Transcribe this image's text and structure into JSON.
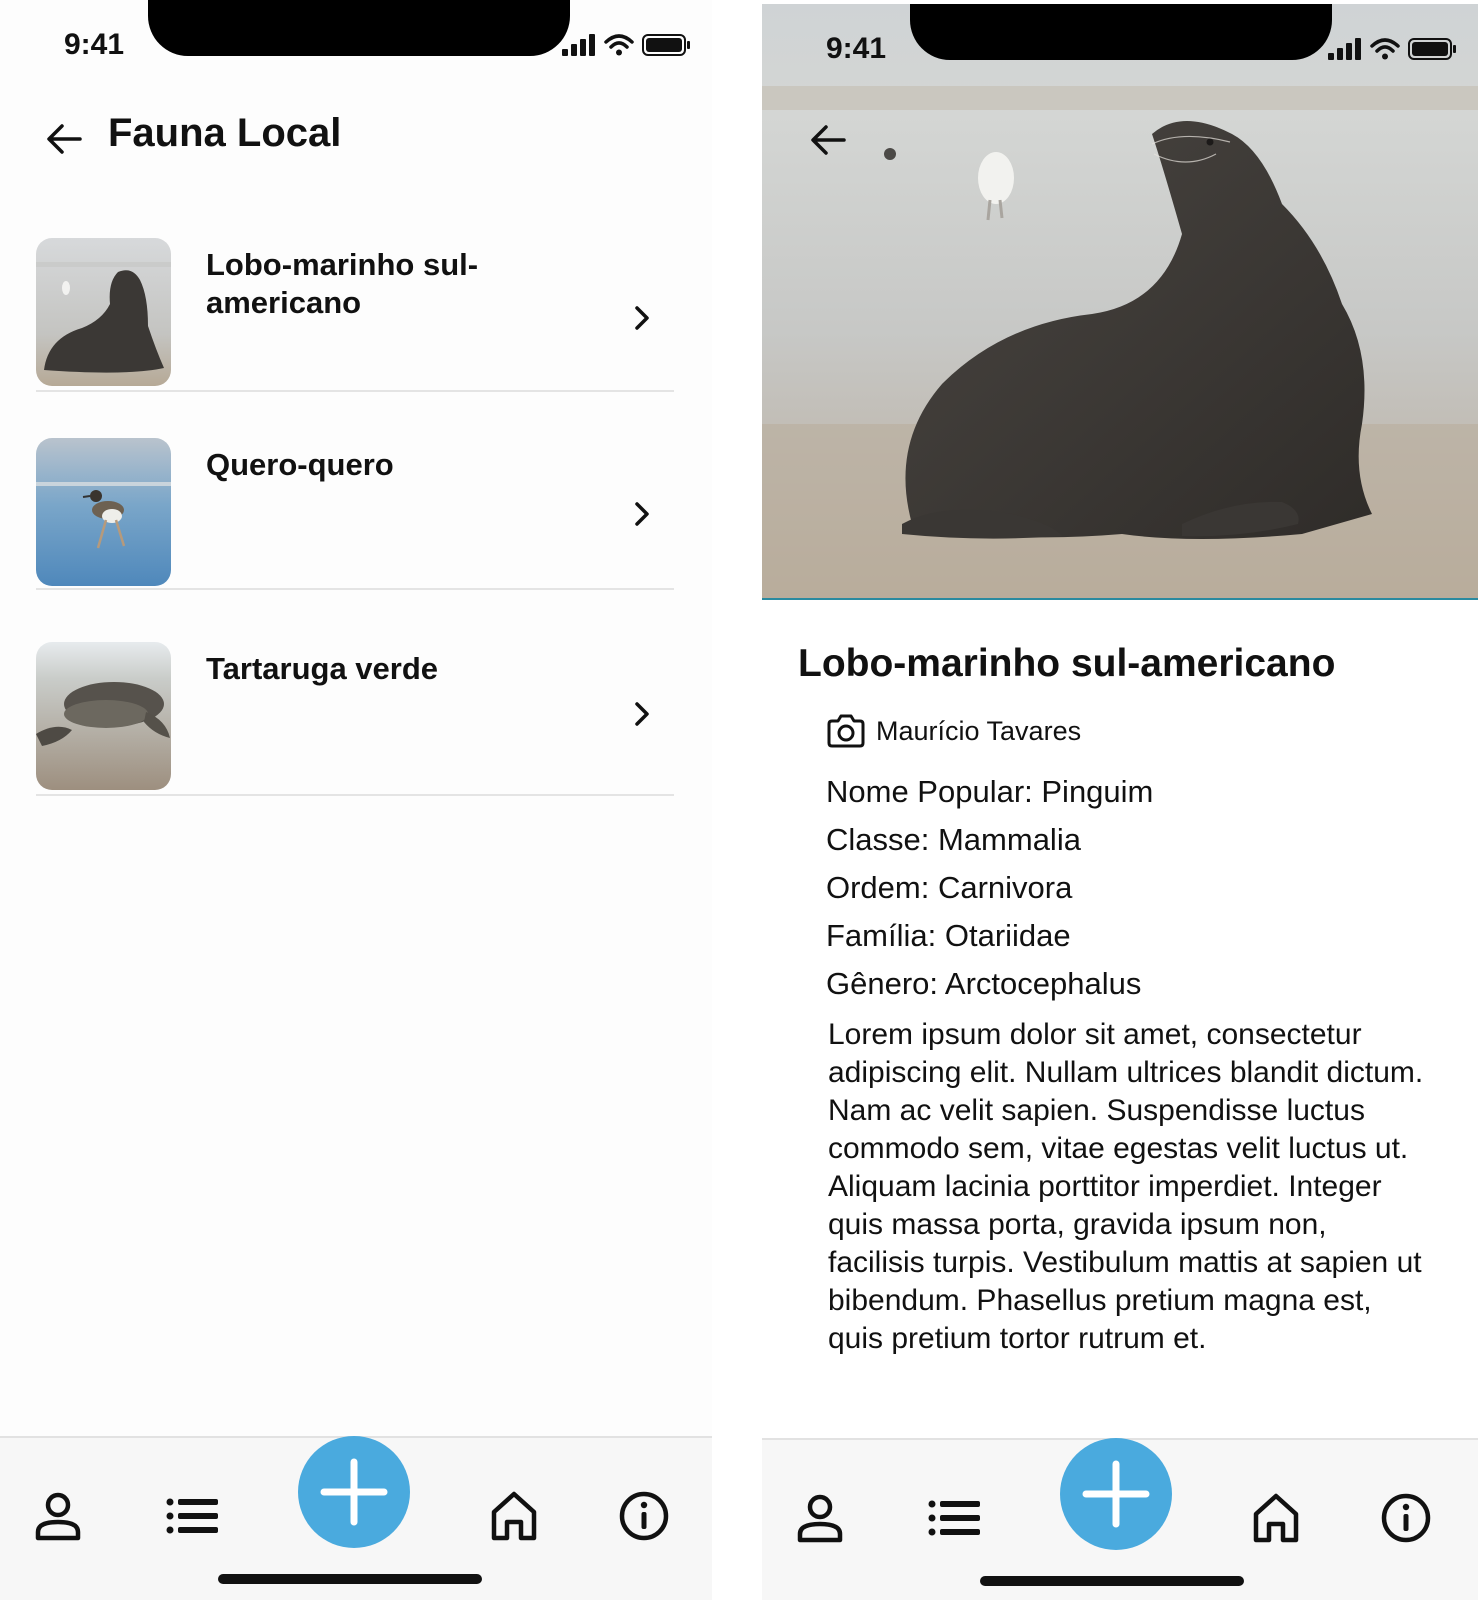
{
  "status_bar": {
    "time": "9:41"
  },
  "list_screen": {
    "title": "Fauna Local",
    "items": [
      {
        "name": "Lobo-marinho sul-americano"
      },
      {
        "name": "Quero-quero"
      },
      {
        "name": "Tartaruga verde"
      }
    ]
  },
  "detail_screen": {
    "title": "Lobo-marinho sul-americano",
    "photo_credit": "Maurício Tavares",
    "facts": [
      "Nome Popular: Pinguim",
      "Classe: Mammalia",
      "Ordem: Carnivora",
      "Família: Otariidae",
      "Gênero: Arctocephalus"
    ],
    "description": "Lorem ipsum dolor sit amet, consectetur adipiscing elit. Nullam ultrices blandit dictum. Nam ac velit sapien. Suspendisse luctus commodo sem, vitae egestas velit luctus ut. Aliquam lacinia porttitor imperdiet. Integer quis massa porta, gravida ipsum non, facilisis turpis. Vestibulum mattis at sapien ut bibendum. Phasellus pretium magna est, quis pretium tortor rutrum et."
  },
  "bottom_nav": {
    "icons": [
      "profile-icon",
      "list-icon",
      "add-icon",
      "home-icon",
      "info-icon"
    ]
  },
  "colors": {
    "accent": "#4aaade",
    "text": "#111111",
    "divider": "#e4e4e4",
    "hero_border": "#2a8aa0"
  }
}
